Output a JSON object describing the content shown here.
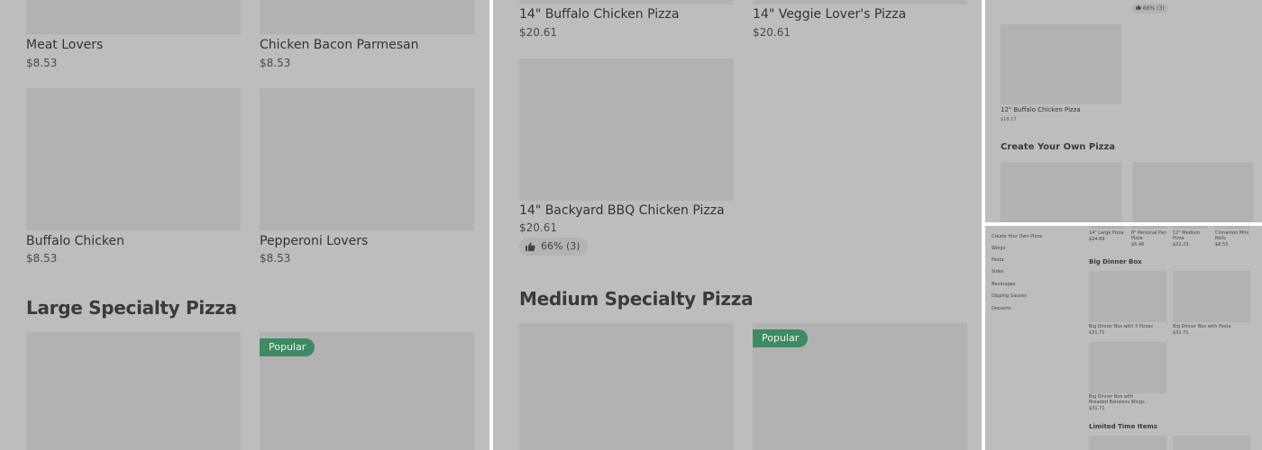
{
  "panel_left": {
    "items": [
      {
        "name": "Meat Lovers",
        "price": "$8.53"
      },
      {
        "name": "Chicken Bacon Parmesan",
        "price": "$8.53"
      },
      {
        "name": "Buffalo Chicken",
        "price": "$8.53"
      },
      {
        "name": "Pepperoni Lovers",
        "price": "$8.53"
      }
    ],
    "section_title": "Large Specialty Pizza",
    "badge": "Popular"
  },
  "panel_middle": {
    "items": [
      {
        "name": "14\" Buffalo Chicken Pizza",
        "price": "$20.61"
      },
      {
        "name": "14\" Veggie Lover's Pizza",
        "price": "$20.61"
      },
      {
        "name": "14\" Backyard BBQ Chicken Pizza",
        "price": "$20.61",
        "rating": "66% (3)"
      }
    ],
    "section_title": "Medium Specialty Pizza",
    "badge": "Popular"
  },
  "panel_right_top": {
    "rating": "66% (3)",
    "item": {
      "name": "12\" Buffalo Chicken Pizza",
      "price": "$18.17"
    },
    "section_title": "Create Your Own Pizza"
  },
  "panel_right_bottom": {
    "nav": [
      "Create Your Own Pizza",
      "Wings",
      "Pasta",
      "Sides",
      "Beverages",
      "Dipping Sauces",
      "Desserts"
    ],
    "top_items": [
      {
        "name": "14\" Large Pizza",
        "price": "$24.69"
      },
      {
        "name": "6\" Personal Pan Pizza",
        "price": "$5.46"
      },
      {
        "name": "12\" Medium Pizza",
        "price": "$22.23"
      },
      {
        "name": "Cinnamon Mini Rolls",
        "price": "$8.53"
      }
    ],
    "section_title": "Big Dinner Box",
    "items": [
      {
        "name": "Big Dinner Box with 3 Pizzas",
        "price": "$31.71"
      },
      {
        "name": "Big Dinner Box with Pasta",
        "price": "$31.71"
      },
      {
        "name": "Big Dinner Box with Breaded Boneless Wings",
        "price": "$31.71"
      }
    ],
    "section_title_2": "Limited Time Items"
  }
}
